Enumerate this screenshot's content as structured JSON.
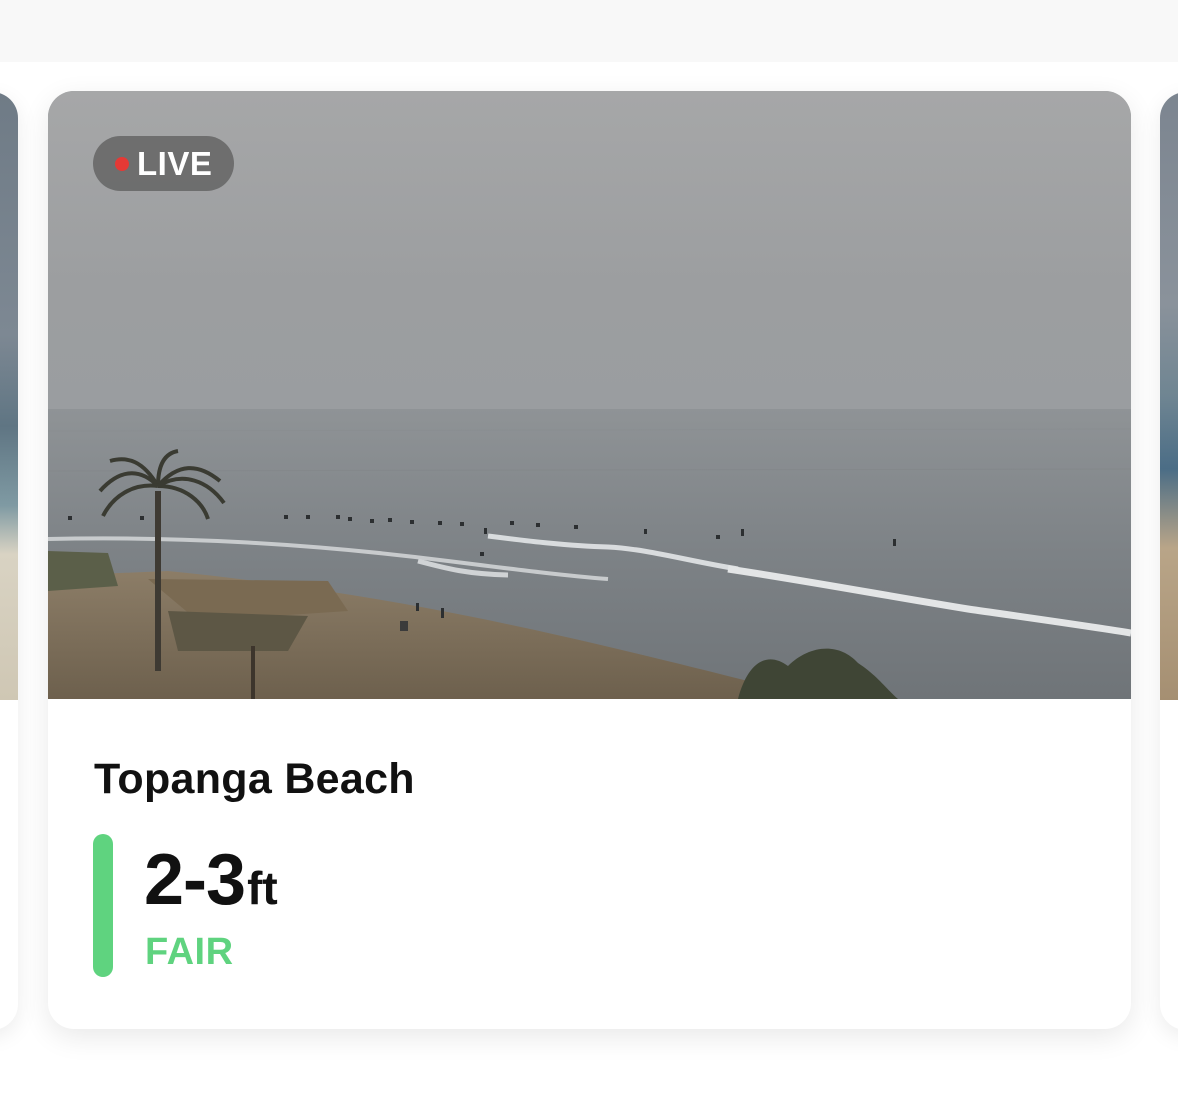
{
  "spot_card": {
    "live_label": "LIVE",
    "name": "Topanga Beach",
    "height_range": "2-3",
    "height_unit": "ft",
    "condition": "FAIR"
  },
  "colors": {
    "condition_fair": "#5fd37f",
    "live_dot": "#e53935",
    "badge_bg": "#5f5f5f"
  },
  "icons": {
    "live": "live-dot-icon"
  }
}
